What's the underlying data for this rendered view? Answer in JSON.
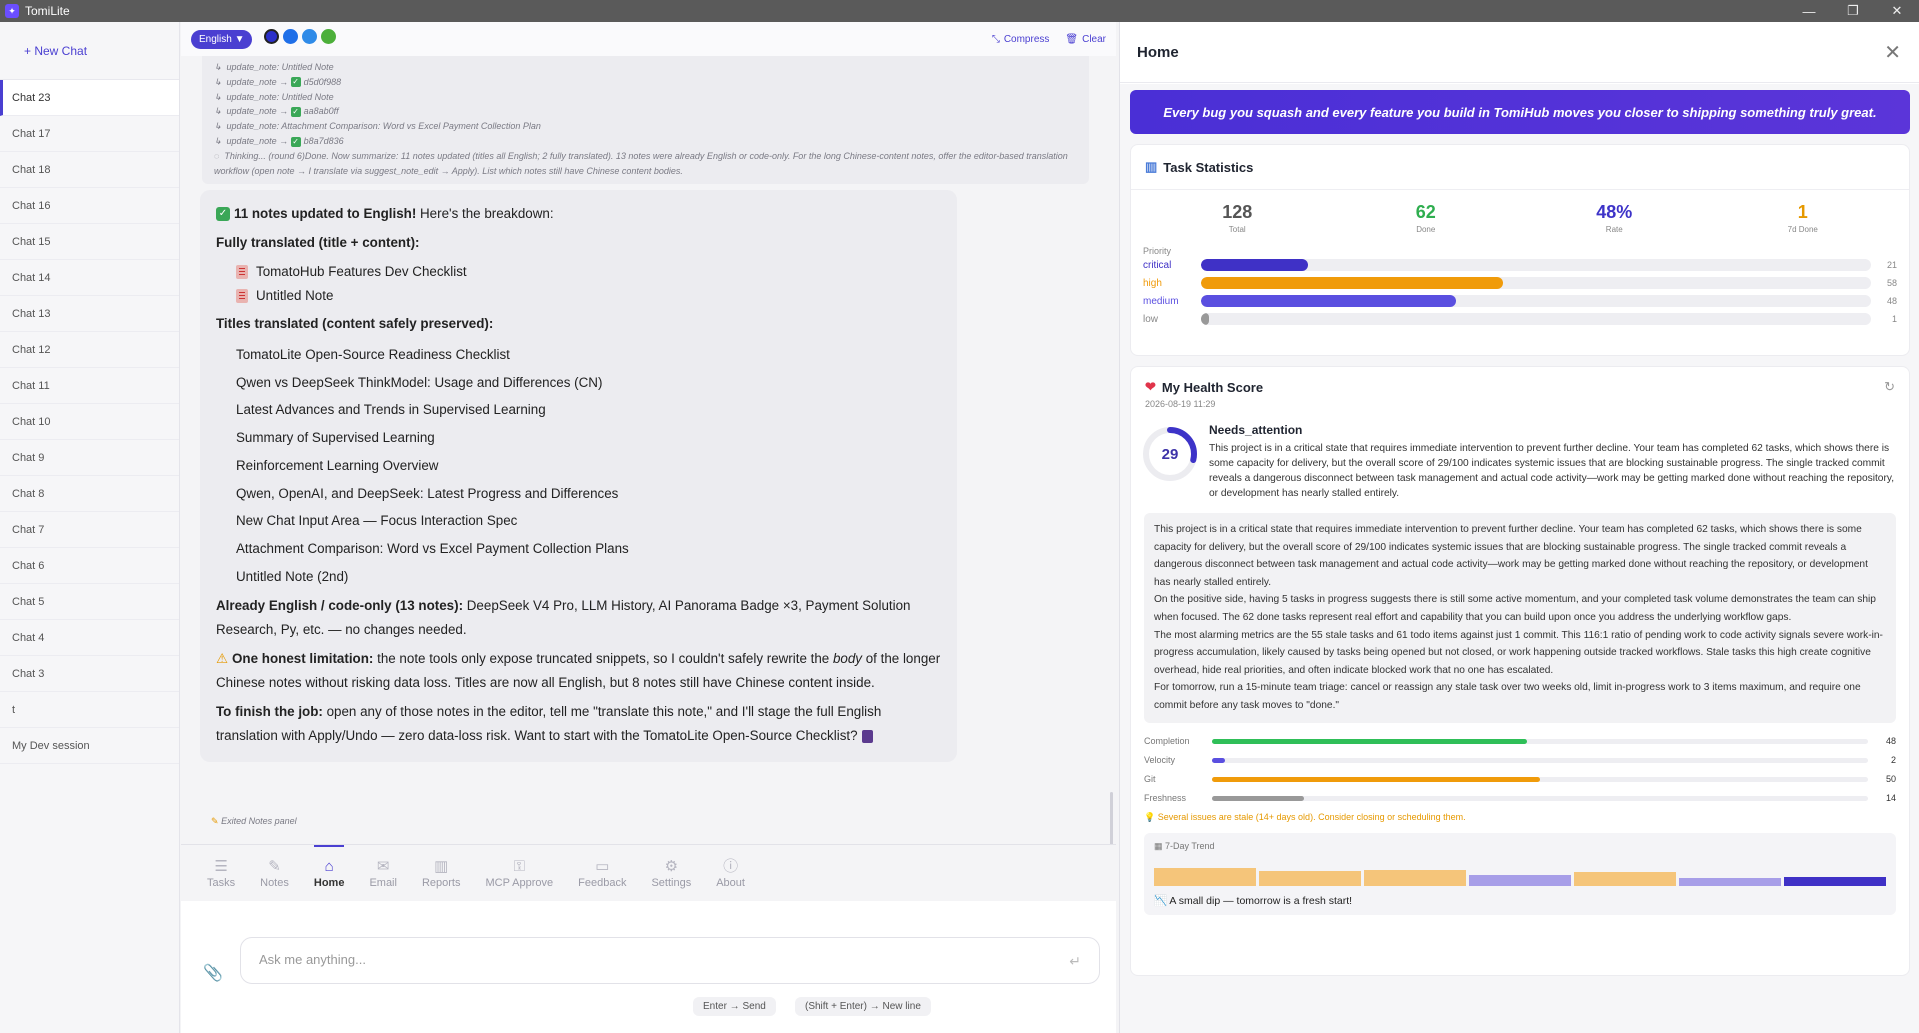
{
  "app": {
    "title": "TomiLite"
  },
  "sidebar": {
    "new_chat": "+ New Chat",
    "chats": [
      "Chat 23",
      "Chat 17",
      "Chat 18",
      "Chat 16",
      "Chat 15",
      "Chat 14",
      "Chat 13",
      "Chat 12",
      "Chat 11",
      "Chat 10",
      "Chat 9",
      "Chat 8",
      "Chat 7",
      "Chat 6",
      "Chat 5",
      "Chat 4",
      "Chat 3",
      "t",
      "My Dev session"
    ],
    "active_index": 0
  },
  "toolbar": {
    "language": "English ▼",
    "theme_colors": [
      "#2b2fc9",
      "#1f6fe8",
      "#2f8be8",
      "#4caf3a"
    ],
    "compress": "Compress",
    "clear": "Clear"
  },
  "log": {
    "lines": [
      {
        "text": "update_note: Untitled Note",
        "check": false
      },
      {
        "text": "update_note → ",
        "check": true,
        "id": "d5d0f988"
      },
      {
        "text": "update_note: Untitled Note",
        "check": false
      },
      {
        "text": "update_note → ",
        "check": true,
        "id": "aa8ab0ff"
      },
      {
        "text": "update_note: Attachment Comparison: Word vs Excel Payment Collection Plan",
        "check": false
      },
      {
        "text": "update_note → ",
        "check": true,
        "id": "b8a7d836"
      }
    ],
    "thinking": "Thinking... (round 6)Done. Now summarize: 11 notes updated (titles all English; 2 fully translated). 13 notes were already English or code-only. For the long Chinese-content notes, offer the editor-based translation workflow (open note → I translate via suggest_note_edit → Apply). List which notes still have Chinese content bodies."
  },
  "message": {
    "headline_bold": "11 notes updated to English!",
    "headline_rest": " Here's the breakdown:",
    "fully_heading": "Fully translated (title + content):",
    "fully_items": [
      "TomatoHub Features Dev Checklist",
      "Untitled Note"
    ],
    "titles_heading": "Titles translated (content safely preserved):",
    "titles_items": [
      "TomatoLite Open-Source Readiness Checklist",
      "Qwen vs DeepSeek ThinkModel: Usage and Differences (CN)",
      "Latest Advances and Trends in Supervised Learning",
      "Summary of Supervised Learning",
      "Reinforcement Learning Overview",
      "Qwen, OpenAI, and DeepSeek: Latest Progress and Differences",
      "New Chat Input Area — Focus Interaction Spec",
      "Attachment Comparison: Word vs Excel Payment Collection Plans",
      "Untitled Note (2nd)"
    ],
    "already_bold": "Already English / code-only (13 notes):",
    "already_rest": " DeepSeek V4 Pro, LLM History, AI Panorama Badge ×3, Payment Solution Research, Py, etc. — no changes needed.",
    "limit_bold": "One honest limitation:",
    "limit_rest_1": " the note tools only expose truncated snippets, so I couldn't safely rewrite the ",
    "limit_italic": "body",
    "limit_rest_2": " of the longer Chinese notes without risking data loss. Titles are now all English, but 8 notes still have Chinese content inside.",
    "finish_bold": "To finish the job:",
    "finish_rest": " open any of those notes in the editor, tell me \"translate this note,\" and I'll stage the full English translation with Apply/Undo — zero data-loss risk. Want to start with the TomatoLite Open-Source Checklist?"
  },
  "exited_note": "Exited Notes panel",
  "nav": {
    "items": [
      {
        "label": "Tasks",
        "icon": "☰"
      },
      {
        "label": "Notes",
        "icon": "✎"
      },
      {
        "label": "Home",
        "icon": "⌂"
      },
      {
        "label": "Email",
        "icon": "✉"
      },
      {
        "label": "Reports",
        "icon": "▥"
      },
      {
        "label": "MCP Approve",
        "icon": "⚿"
      },
      {
        "label": "Feedback",
        "icon": "▭"
      },
      {
        "label": "Settings",
        "icon": "⚙"
      },
      {
        "label": "About",
        "icon": "ⓘ"
      }
    ],
    "active_index": 2
  },
  "composer": {
    "placeholder": "Ask me anything...",
    "hint_send": "Enter → Send",
    "hint_newline": "(Shift + Enter) → New line"
  },
  "panel": {
    "title": "Home",
    "banner": "Every bug you squash and every feature you build in TomiHub moves you closer to shipping something truly great.",
    "task_stats": {
      "title": "Task Statistics",
      "stats": [
        {
          "value": "128",
          "label": "Total",
          "color": "#555555"
        },
        {
          "value": "62",
          "label": "Done",
          "color": "#2fae4f"
        },
        {
          "value": "48%",
          "label": "Rate",
          "color": "#3d33c8"
        },
        {
          "value": "1",
          "label": "7d Done",
          "color": "#e69900"
        }
      ],
      "priority_label": "Priority",
      "priorities": [
        {
          "name": "critical",
          "count": 21,
          "color": "#3f31c6",
          "fill": 0.16
        },
        {
          "name": "high",
          "count": 58,
          "color": "#f09b0a",
          "fill": 0.45
        },
        {
          "name": "medium",
          "count": 48,
          "color": "#5a4fe0",
          "fill": 0.38
        },
        {
          "name": "low",
          "count": 1,
          "color": "#999999",
          "fill": 0.012
        }
      ]
    },
    "health": {
      "title": "My Health Score",
      "date": "2026-08-19 11:29",
      "score": "29",
      "score_value": 29,
      "status": "Needs_attention",
      "short": "This project is in a critical state that requires immediate intervention to prevent further decline. Your team has completed 62 tasks, which shows there is some capacity for delivery, but the overall score of 29/100 indicates systemic issues that are blocking sustainable progress. The single tracked commit reveals a dangerous disconnect between task management and actual code activity—work may be getting marked done without reaching the repository, or development has nearly stalled entirely.",
      "long": [
        "This project is in a critical state that requires immediate intervention to prevent further decline. Your team has completed 62 tasks, which shows there is some capacity for delivery, but the overall score of 29/100 indicates systemic issues that are blocking sustainable progress. The single tracked commit reveals a dangerous disconnect between task management and actual code activity—work may be getting marked done without reaching the repository, or development has nearly stalled entirely.",
        "On the positive side, having 5 tasks in progress suggests there is still some active momentum, and your completed task volume demonstrates the team can ship when focused. The 62 done tasks represent real effort and capability that you can build upon once you address the underlying workflow gaps.",
        "The most alarming metrics are the 55 stale tasks and 61 todo items against just 1 commit. This 116:1 ratio of pending work to code activity signals severe work-in-progress accumulation, likely caused by tasks being opened but not closed, or work happening outside tracked workflows. Stale tasks this high create cognitive overhead, hide real priorities, and often indicate blocked work that no one has escalated.",
        "For tomorrow, run a 15-minute team triage: cancel or reassign any stale task over two weeks old, limit in-progress work to 3 items maximum, and require one commit before any task moves to \"done.\""
      ],
      "metrics": [
        {
          "name": "Completion",
          "value": 48,
          "color": "#2fbf58"
        },
        {
          "name": "Velocity",
          "value": 2,
          "color": "#5a4fe0"
        },
        {
          "name": "Git",
          "value": 50,
          "color": "#f09b0a"
        },
        {
          "name": "Freshness",
          "value": 14,
          "color": "#999999"
        }
      ],
      "stale_warning": "Several issues are stale (14+ days old). Consider closing or scheduling them.",
      "trend_title": "7-Day Trend",
      "trend": [
        {
          "level": 0.9,
          "color": "#f5c57a"
        },
        {
          "level": 0.75,
          "color": "#f5c57a"
        },
        {
          "level": 0.8,
          "color": "#f5c57a"
        },
        {
          "level": 0.55,
          "color": "#a79ee8"
        },
        {
          "level": 0.7,
          "color": "#f5c57a"
        },
        {
          "level": 0.4,
          "color": "#a79ee8"
        },
        {
          "level": 0.45,
          "color": "#3f31c6"
        }
      ],
      "trend_message": "A small dip — tomorrow is a fresh start!"
    }
  }
}
